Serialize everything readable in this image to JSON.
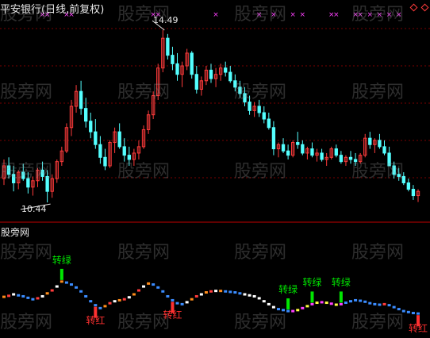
{
  "window": {
    "title": "平安银行(日线,前复权)",
    "subpanel_title": "股旁网"
  },
  "watermark": {
    "text": "股旁网"
  },
  "colors": {
    "background": "#000000",
    "up_candle": "#ff3b3b",
    "down_candle": "#54ffff",
    "grid": "#7a0000",
    "divider": "#c00000",
    "signal_green": "#00e600",
    "signal_red": "#ff3030",
    "magenta": "#ff40ff",
    "blue": "#3b8cff",
    "white": "#ffffff",
    "yellow": "#ffff40",
    "orange": "#ff8c1a"
  },
  "chart_data": {
    "type": "candlestick",
    "title": "平安银行(日线,前复权)",
    "ylim": [
      10.2,
      14.9
    ],
    "annotations": {
      "high": {
        "label": "14.49",
        "value": 14.49
      },
      "low": {
        "label": "10.44",
        "value": 10.44
      }
    },
    "candles": [
      [
        11.0,
        11.45,
        10.85,
        11.3
      ],
      [
        11.3,
        11.5,
        11.0,
        11.1
      ],
      [
        11.1,
        11.3,
        10.7,
        10.9
      ],
      [
        10.9,
        11.2,
        10.75,
        11.15
      ],
      [
        11.15,
        11.35,
        10.95,
        11.0
      ],
      [
        11.0,
        11.15,
        10.65,
        10.8
      ],
      [
        10.8,
        11.05,
        10.6,
        10.95
      ],
      [
        10.95,
        11.25,
        10.8,
        11.2
      ],
      [
        11.2,
        11.4,
        10.95,
        11.05
      ],
      [
        11.05,
        11.2,
        10.44,
        10.7
      ],
      [
        10.7,
        11.1,
        10.55,
        11.0
      ],
      [
        11.0,
        11.45,
        10.9,
        11.4
      ],
      [
        11.4,
        11.75,
        11.3,
        11.65
      ],
      [
        11.65,
        12.3,
        11.6,
        12.2
      ],
      [
        12.2,
        12.85,
        12.0,
        12.7
      ],
      [
        12.7,
        13.2,
        12.55,
        13.05
      ],
      [
        13.05,
        13.3,
        12.5,
        12.65
      ],
      [
        12.65,
        12.9,
        12.2,
        12.35
      ],
      [
        12.35,
        12.55,
        11.95,
        12.1
      ],
      [
        12.1,
        12.4,
        11.7,
        11.8
      ],
      [
        11.8,
        12.0,
        11.35,
        11.5
      ],
      [
        11.5,
        11.7,
        11.2,
        11.3
      ],
      [
        11.3,
        11.9,
        11.25,
        11.85
      ],
      [
        11.85,
        12.2,
        11.6,
        12.1
      ],
      [
        12.1,
        12.3,
        11.7,
        11.75
      ],
      [
        11.75,
        11.95,
        11.4,
        11.55
      ],
      [
        11.55,
        11.75,
        11.3,
        11.45
      ],
      [
        11.45,
        11.7,
        11.3,
        11.6
      ],
      [
        11.6,
        11.9,
        11.45,
        11.75
      ],
      [
        11.75,
        12.25,
        11.7,
        12.15
      ],
      [
        12.15,
        12.6,
        12.05,
        12.5
      ],
      [
        12.5,
        13.05,
        12.4,
        12.95
      ],
      [
        12.95,
        13.7,
        12.85,
        13.6
      ],
      [
        13.6,
        14.49,
        13.5,
        14.3
      ],
      [
        14.3,
        14.4,
        13.8,
        13.9
      ],
      [
        13.9,
        14.1,
        13.55,
        13.7
      ],
      [
        13.7,
        13.95,
        13.3,
        13.45
      ],
      [
        13.45,
        13.75,
        13.15,
        13.65
      ],
      [
        13.65,
        14.05,
        13.55,
        13.95
      ],
      [
        13.95,
        14.0,
        13.35,
        13.45
      ],
      [
        13.45,
        13.65,
        13.0,
        13.1
      ],
      [
        13.1,
        13.4,
        12.95,
        13.3
      ],
      [
        13.3,
        13.65,
        13.2,
        13.55
      ],
      [
        13.55,
        13.7,
        13.25,
        13.35
      ],
      [
        13.35,
        13.6,
        13.15,
        13.45
      ],
      [
        13.45,
        13.7,
        13.3,
        13.6
      ],
      [
        13.6,
        13.75,
        13.4,
        13.5
      ],
      [
        13.5,
        13.65,
        13.25,
        13.3
      ],
      [
        13.3,
        13.45,
        13.05,
        13.15
      ],
      [
        13.15,
        13.3,
        12.9,
        13.0
      ],
      [
        13.0,
        13.15,
        12.7,
        12.8
      ],
      [
        12.8,
        12.95,
        12.5,
        12.6
      ],
      [
        12.6,
        12.8,
        12.45,
        12.7
      ],
      [
        12.7,
        12.85,
        12.45,
        12.55
      ],
      [
        12.55,
        12.7,
        12.3,
        12.4
      ],
      [
        12.4,
        12.55,
        12.15,
        12.2
      ],
      [
        12.2,
        12.35,
        11.55,
        11.7
      ],
      [
        11.7,
        11.85,
        11.5,
        11.8
      ],
      [
        11.8,
        11.95,
        11.6,
        11.65
      ],
      [
        11.65,
        11.8,
        11.45,
        11.55
      ],
      [
        11.55,
        11.9,
        11.5,
        11.85
      ],
      [
        11.85,
        12.1,
        11.7,
        11.8
      ],
      [
        11.8,
        11.9,
        11.55,
        11.6
      ],
      [
        11.6,
        11.75,
        11.45,
        11.7
      ],
      [
        11.7,
        11.85,
        11.5,
        11.55
      ],
      [
        11.55,
        11.7,
        11.4,
        11.6
      ],
      [
        11.6,
        11.7,
        11.4,
        11.45
      ],
      [
        11.45,
        11.6,
        11.3,
        11.5
      ],
      [
        11.5,
        11.75,
        11.45,
        11.7
      ],
      [
        11.7,
        11.8,
        11.5,
        11.55
      ],
      [
        11.55,
        11.65,
        11.35,
        11.4
      ],
      [
        11.4,
        11.55,
        11.3,
        11.5
      ],
      [
        11.5,
        11.65,
        11.35,
        11.45
      ],
      [
        11.45,
        11.6,
        11.3,
        11.4
      ],
      [
        11.4,
        11.6,
        11.35,
        11.55
      ],
      [
        11.55,
        12.05,
        11.5,
        11.95
      ],
      [
        11.95,
        12.1,
        11.7,
        11.8
      ],
      [
        11.8,
        11.95,
        11.6,
        11.9
      ],
      [
        11.9,
        12.05,
        11.7,
        11.75
      ],
      [
        11.75,
        11.9,
        11.55,
        11.6
      ],
      [
        11.6,
        11.75,
        11.4,
        11.3
      ],
      [
        11.3,
        11.4,
        11.0,
        11.1
      ],
      [
        11.1,
        11.25,
        10.95,
        11.05
      ],
      [
        11.05,
        11.15,
        10.85,
        10.9
      ],
      [
        10.9,
        11.0,
        10.7,
        10.75
      ],
      [
        10.75,
        10.85,
        10.5,
        10.6
      ],
      [
        10.6,
        10.75,
        10.45,
        10.7
      ]
    ],
    "indicator": {
      "ylim": [
        0,
        1
      ],
      "line": [
        0.45,
        0.47,
        0.5,
        0.48,
        0.46,
        0.43,
        0.4,
        0.42,
        0.46,
        0.52,
        0.58,
        0.66,
        0.76,
        0.74,
        0.7,
        0.64,
        0.56,
        0.46,
        0.36,
        0.28,
        0.22,
        0.26,
        0.32,
        0.36,
        0.38,
        0.4,
        0.44,
        0.5,
        0.58,
        0.66,
        0.72,
        0.7,
        0.64,
        0.56,
        0.46,
        0.38,
        0.32,
        0.3,
        0.34,
        0.4,
        0.46,
        0.5,
        0.54,
        0.56,
        0.57,
        0.57,
        0.56,
        0.55,
        0.54,
        0.52,
        0.5,
        0.48,
        0.46,
        0.42,
        0.36,
        0.3,
        0.24,
        0.2,
        0.18,
        0.16,
        0.16,
        0.18,
        0.22,
        0.26,
        0.3,
        0.33,
        0.34,
        0.33,
        0.31,
        0.29,
        0.3,
        0.33,
        0.36,
        0.38,
        0.37,
        0.35,
        0.32,
        0.3,
        0.29,
        0.3,
        0.28,
        0.24,
        0.2,
        0.16,
        0.14,
        0.12,
        0.11
      ],
      "signals": [
        {
          "text": "转绿",
          "type": "green"
        },
        {
          "text": "转红",
          "type": "red"
        },
        {
          "text": "转红",
          "type": "red"
        },
        {
          "text": "转绿",
          "type": "green"
        },
        {
          "text": "转绿",
          "type": "green"
        },
        {
          "text": "转绿",
          "type": "green"
        },
        {
          "text": "转红",
          "type": "red"
        }
      ]
    }
  }
}
